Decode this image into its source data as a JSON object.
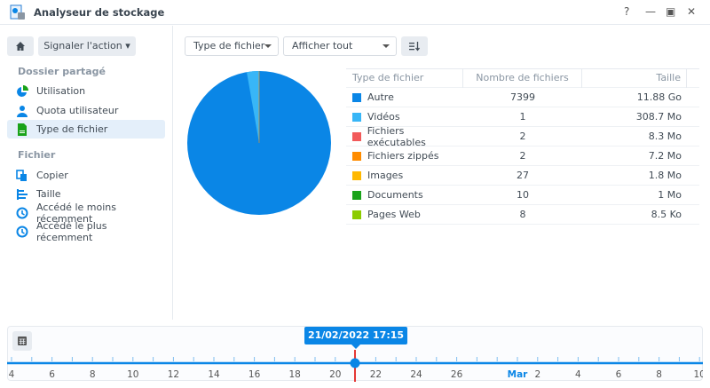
{
  "window": {
    "title": "Analyseur de stockage",
    "help": "?",
    "minimize": "—",
    "maximize": "▣",
    "close": "✕"
  },
  "sidebar": {
    "action_label": "Signaler l'action",
    "section1": "Dossier partagé",
    "section2": "Fichier",
    "items1": [
      {
        "label": "Utilisation"
      },
      {
        "label": "Quota utilisateur"
      },
      {
        "label": "Type de fichier"
      }
    ],
    "items2": [
      {
        "label": "Copier"
      },
      {
        "label": "Taille"
      },
      {
        "label": "Accédé le moins récemment"
      },
      {
        "label": "Accédé le plus récemment"
      }
    ]
  },
  "toolbar": {
    "group_by": "Type de fichier",
    "filter": "Afficher tout"
  },
  "table": {
    "headers": [
      "Type de fichier",
      "Nombre de fichiers",
      "Taille"
    ],
    "rows": [
      {
        "type": "Autre",
        "count": "7399",
        "size": "11.88 Go",
        "color": "#0a86e6"
      },
      {
        "type": "Vidéos",
        "count": "1",
        "size": "308.7 Mo",
        "color": "#38b6f7"
      },
      {
        "type": "Fichiers exécutables",
        "count": "2",
        "size": "8.3 Mo",
        "color": "#f25a5a"
      },
      {
        "type": "Fichiers zippés",
        "count": "2",
        "size": "7.2 Mo",
        "color": "#ff8c00"
      },
      {
        "type": "Images",
        "count": "27",
        "size": "1.8 Mo",
        "color": "#ffb800"
      },
      {
        "type": "Documents",
        "count": "10",
        "size": "1 Mo",
        "color": "#1aa31a"
      },
      {
        "type": "Pages Web",
        "count": "8",
        "size": "8.5 Ko",
        "color": "#8ccc00"
      }
    ]
  },
  "timeline": {
    "selected": "21/02/2022 17:15",
    "labels": [
      "4",
      "6",
      "8",
      "10",
      "12",
      "14",
      "16",
      "18",
      "20",
      "22",
      "24",
      "26",
      "Mar",
      "2",
      "4",
      "6",
      "8",
      "10"
    ],
    "accent": "#0a86e6"
  }
}
